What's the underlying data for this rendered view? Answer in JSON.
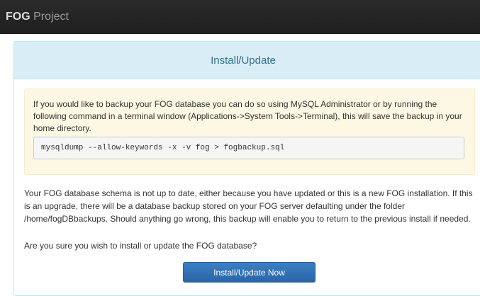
{
  "navbar": {
    "brand_strong": "FOG",
    "brand_rest": " Project"
  },
  "panel": {
    "title": "Install/Update",
    "warning": {
      "text": "If you would like to backup your FOG database you can do so using MySQL Administrator or by running the following command in a terminal window (Applications->System Tools->Terminal), this will save the backup in your home directory.",
      "command": "mysqldump --allow-keywords -x -v fog > fogbackup.sql"
    },
    "body_text": "Your FOG database schema is not up to date, either because you have updated or this is a new FOG installation. If this is an upgrade, there will be a database backup stored on your FOG server defaulting under the folder /home/fogDBbackups. Should anything go wrong, this backup will enable you to return to the previous install if needed.",
    "confirm_text": "Are you sure you wish to install or update the FOG database?",
    "button_label": "Install/Update Now"
  },
  "colors": {
    "navbar_bg": "#222222",
    "panel_heading_bg": "#d9edf7",
    "panel_heading_text": "#31708f",
    "warning_bg": "#fcf8e3",
    "button_bg": "#337ab7"
  }
}
